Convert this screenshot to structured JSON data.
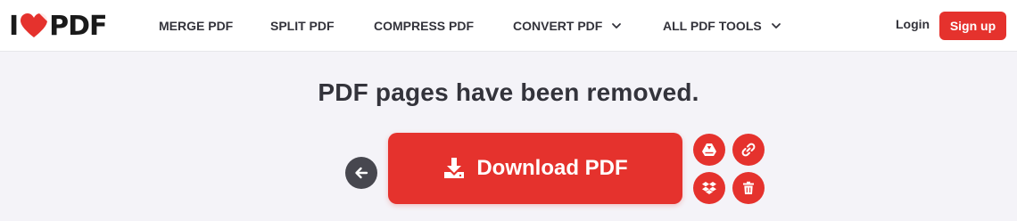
{
  "header": {
    "logo": {
      "left_text": "I",
      "right_text": "PDF",
      "icon": "heart-icon"
    },
    "nav": [
      {
        "label": "MERGE PDF"
      },
      {
        "label": "SPLIT PDF"
      },
      {
        "label": "COMPRESS PDF"
      },
      {
        "label": "CONVERT PDF",
        "icon": "chevron-down-icon"
      },
      {
        "label": "ALL PDF TOOLS",
        "icon": "chevron-down-icon"
      }
    ],
    "login_label": "Login",
    "signup_label": "Sign up"
  },
  "main": {
    "title": "PDF pages have been removed.",
    "download_label": "Download PDF",
    "actions": [
      {
        "name": "google-drive",
        "icon": "google-drive-icon"
      },
      {
        "name": "copy-link",
        "icon": "link-icon"
      },
      {
        "name": "dropbox",
        "icon": "dropbox-icon"
      },
      {
        "name": "delete",
        "icon": "trash-icon"
      }
    ]
  },
  "colors": {
    "accent": "#e5322d",
    "page_bg": "#f4f3f8",
    "header_bg": "#ffffff",
    "text": "#33333b",
    "back_button": "#47474f"
  }
}
